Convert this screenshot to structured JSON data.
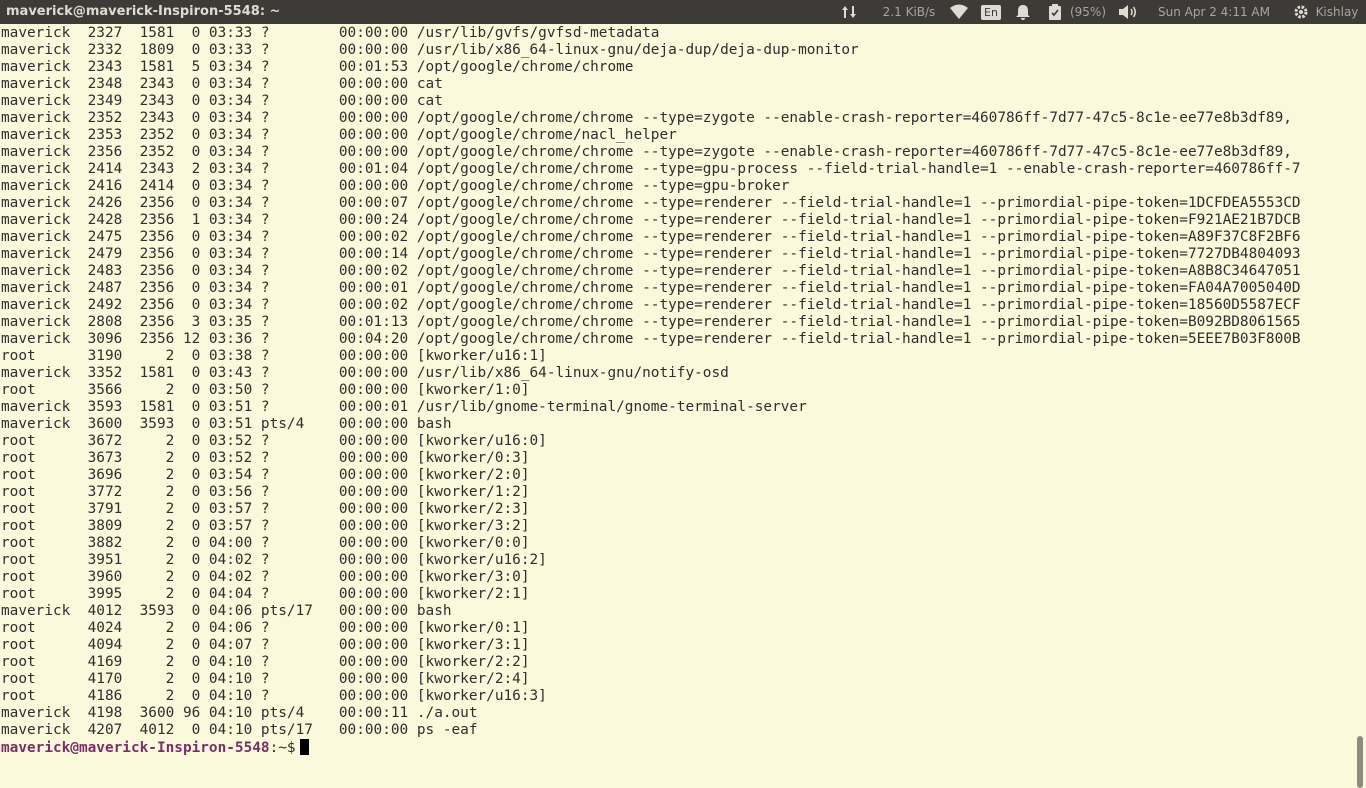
{
  "window": {
    "title": "maverick@maverick-Inspiron-5548: ~"
  },
  "indicators": {
    "network_speed": "2.1 KiB/s",
    "keyboard_layout": "En",
    "battery": "(95%)",
    "datetime": "Sun Apr  2  4:11 AM",
    "user": "Kishlay"
  },
  "terminal": {
    "lines": [
      "maverick  2327  1581  0 03:33 ?        00:00:00 /usr/lib/gvfs/gvfsd-metadata",
      "maverick  2332  1809  0 03:33 ?        00:00:00 /usr/lib/x86_64-linux-gnu/deja-dup/deja-dup-monitor",
      "maverick  2343  1581  5 03:34 ?        00:01:53 /opt/google/chrome/chrome",
      "maverick  2348  2343  0 03:34 ?        00:00:00 cat",
      "maverick  2349  2343  0 03:34 ?        00:00:00 cat",
      "maverick  2352  2343  0 03:34 ?        00:00:00 /opt/google/chrome/chrome --type=zygote --enable-crash-reporter=460786ff-7d77-47c5-8c1e-ee77e8b3df89,",
      "maverick  2353  2352  0 03:34 ?        00:00:00 /opt/google/chrome/nacl_helper",
      "maverick  2356  2352  0 03:34 ?        00:00:00 /opt/google/chrome/chrome --type=zygote --enable-crash-reporter=460786ff-7d77-47c5-8c1e-ee77e8b3df89,",
      "maverick  2414  2343  2 03:34 ?        00:01:04 /opt/google/chrome/chrome --type=gpu-process --field-trial-handle=1 --enable-crash-reporter=460786ff-7",
      "maverick  2416  2414  0 03:34 ?        00:00:00 /opt/google/chrome/chrome --type=gpu-broker",
      "maverick  2426  2356  0 03:34 ?        00:00:07 /opt/google/chrome/chrome --type=renderer --field-trial-handle=1 --primordial-pipe-token=1DCFDEA5553CD",
      "maverick  2428  2356  1 03:34 ?        00:00:24 /opt/google/chrome/chrome --type=renderer --field-trial-handle=1 --primordial-pipe-token=F921AE21B7DCB",
      "maverick  2475  2356  0 03:34 ?        00:00:02 /opt/google/chrome/chrome --type=renderer --field-trial-handle=1 --primordial-pipe-token=A89F37C8F2BF6",
      "maverick  2479  2356  0 03:34 ?        00:00:14 /opt/google/chrome/chrome --type=renderer --field-trial-handle=1 --primordial-pipe-token=7727DB4804093",
      "maverick  2483  2356  0 03:34 ?        00:00:02 /opt/google/chrome/chrome --type=renderer --field-trial-handle=1 --primordial-pipe-token=A8B8C34647051",
      "maverick  2487  2356  0 03:34 ?        00:00:01 /opt/google/chrome/chrome --type=renderer --field-trial-handle=1 --primordial-pipe-token=FA04A7005040D",
      "maverick  2492  2356  0 03:34 ?        00:00:02 /opt/google/chrome/chrome --type=renderer --field-trial-handle=1 --primordial-pipe-token=18560D5587ECF",
      "maverick  2808  2356  3 03:35 ?        00:01:13 /opt/google/chrome/chrome --type=renderer --field-trial-handle=1 --primordial-pipe-token=B092BD8061565",
      "maverick  3096  2356 12 03:36 ?        00:04:20 /opt/google/chrome/chrome --type=renderer --field-trial-handle=1 --primordial-pipe-token=5EEE7B03F800B",
      "root      3190     2  0 03:38 ?        00:00:00 [kworker/u16:1]",
      "maverick  3352  1581  0 03:43 ?        00:00:00 /usr/lib/x86_64-linux-gnu/notify-osd",
      "root      3566     2  0 03:50 ?        00:00:00 [kworker/1:0]",
      "maverick  3593  1581  0 03:51 ?        00:00:01 /usr/lib/gnome-terminal/gnome-terminal-server",
      "maverick  3600  3593  0 03:51 pts/4    00:00:00 bash",
      "root      3672     2  0 03:52 ?        00:00:00 [kworker/u16:0]",
      "root      3673     2  0 03:52 ?        00:00:00 [kworker/0:3]",
      "root      3696     2  0 03:54 ?        00:00:00 [kworker/2:0]",
      "root      3772     2  0 03:56 ?        00:00:00 [kworker/1:2]",
      "root      3791     2  0 03:57 ?        00:00:00 [kworker/2:3]",
      "root      3809     2  0 03:57 ?        00:00:00 [kworker/3:2]",
      "root      3882     2  0 04:00 ?        00:00:00 [kworker/0:0]",
      "root      3951     2  0 04:02 ?        00:00:00 [kworker/u16:2]",
      "root      3960     2  0 04:02 ?        00:00:00 [kworker/3:0]",
      "root      3995     2  0 04:04 ?        00:00:00 [kworker/2:1]",
      "maverick  4012  3593  0 04:06 pts/17   00:00:00 bash",
      "root      4024     2  0 04:06 ?        00:00:00 [kworker/0:1]",
      "root      4094     2  0 04:07 ?        00:00:00 [kworker/3:1]",
      "root      4169     2  0 04:10 ?        00:00:00 [kworker/2:2]",
      "root      4170     2  0 04:10 ?        00:00:00 [kworker/2:4]",
      "root      4186     2  0 04:10 ?        00:00:00 [kworker/u16:3]",
      "maverick  4198  3600 96 04:10 pts/4    00:00:11 ./a.out",
      "maverick  4207  4012  0 04:10 pts/17   00:00:00 ps -eaf"
    ],
    "prompt_user": "maverick@maverick-Inspiron-5548",
    "prompt_suffix": ":~$"
  },
  "colors": {
    "background": "#fbf9dc",
    "text": "#2e2e2e",
    "prompt": "#7a2e68",
    "topbar": "#3c3b37"
  }
}
